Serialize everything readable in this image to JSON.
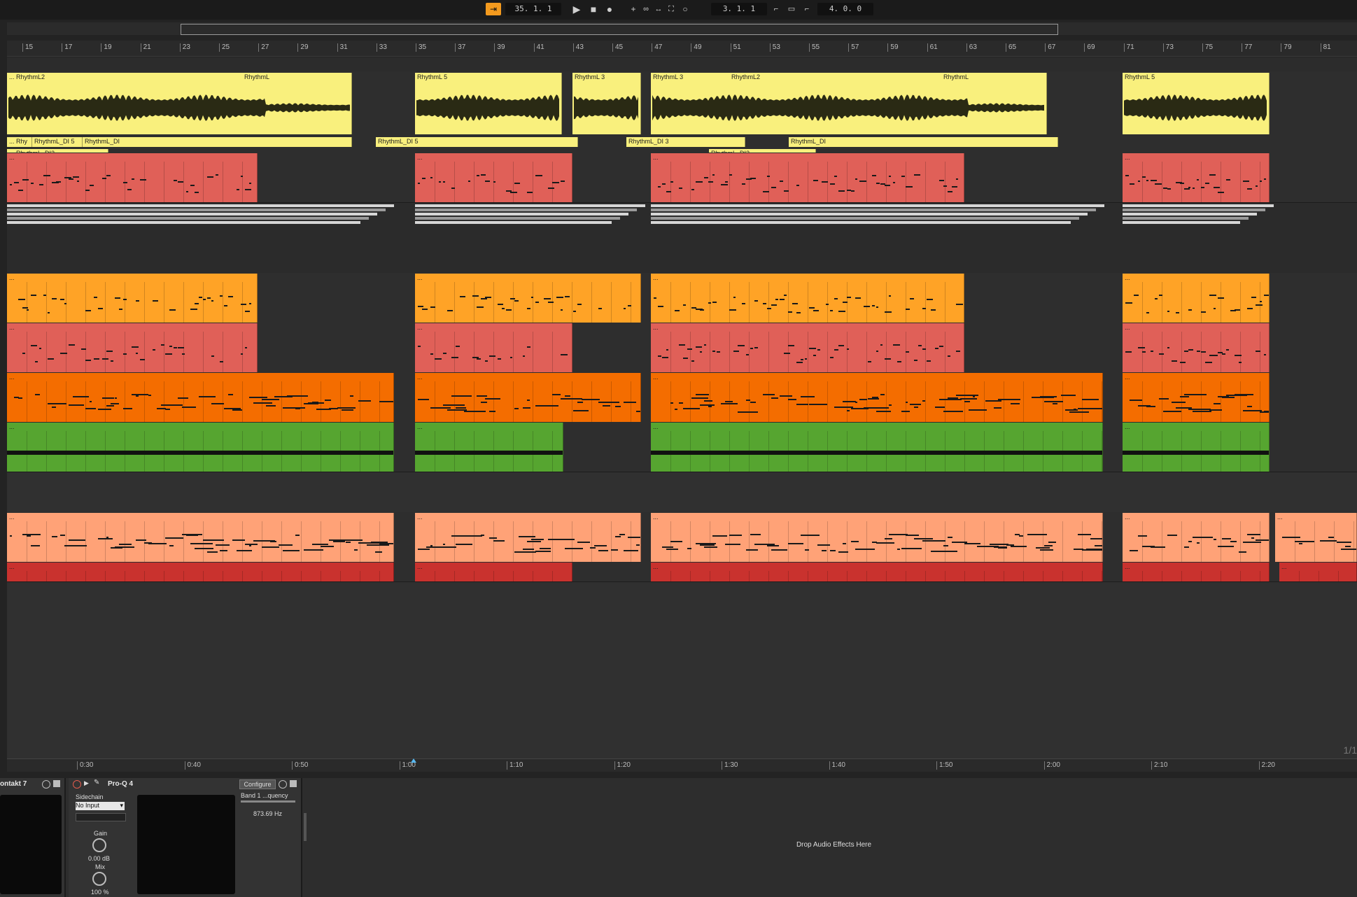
{
  "transport": {
    "position": "35.  1.  1",
    "loop_start": "3.  1.  1",
    "loop_length": "4.  0.  0"
  },
  "ruler": {
    "bars": [
      "15",
      "17",
      "19",
      "21",
      "23",
      "25",
      "27",
      "29",
      "31",
      "33",
      "35",
      "37",
      "39",
      "41",
      "43",
      "45",
      "47",
      "49",
      "51",
      "53",
      "55",
      "57",
      "59",
      "61",
      "63",
      "65",
      "67",
      "69",
      "71",
      "73",
      "75",
      "77",
      "79",
      "81"
    ]
  },
  "time_ruler": {
    "marks": [
      "0:30",
      "0:40",
      "0:50",
      "1:00",
      "1:10",
      "1:20",
      "1:30",
      "1:40",
      "1:50",
      "2:00",
      "2:10",
      "2:20"
    ]
  },
  "audio_clips": [
    {
      "name": "... RhythmL2"
    },
    {
      "name": "RhythmL"
    },
    {
      "name": "RhythmL 5"
    },
    {
      "name": "RhythmL 3"
    },
    {
      "name": "RhythmL 3"
    },
    {
      "name": "RhythmL2"
    },
    {
      "name": "RhythmL"
    },
    {
      "name": "RhythmL 5"
    }
  ],
  "di_clips": [
    {
      "name": "... Rhy"
    },
    {
      "name": "RhythmL_DI 5"
    },
    {
      "name": "RhythmL_DI"
    },
    {
      "name": "RhythmL_DI 5"
    },
    {
      "name": "RhythmL_DI 3"
    },
    {
      "name": "RhythmL_DI"
    },
    {
      "name": "... RhythmL_DI2"
    },
    {
      "name": "RhythmL_DI2"
    }
  ],
  "colors": {
    "yellow": "#f9f07d",
    "salmon_red": "#e06058",
    "amber": "#ffa326",
    "orange": "#f46d00",
    "green": "#56a530",
    "peach": "#ffa277",
    "dark_red": "#c9322e"
  },
  "page_indicator": "1/1",
  "devices": {
    "kontakt": {
      "title": "ontakt 7"
    },
    "proq": {
      "title": "Pro-Q 4",
      "sidechain_label": "Sidechain",
      "sidechain_value": "No Input",
      "gain_label": "Gain",
      "gain_value": "0.00 dB",
      "mix_label": "Mix",
      "mix_value": "100 %",
      "configure_label": "Configure",
      "band_label": "Band 1 ...quency",
      "band_value": "873.69 Hz"
    },
    "drop_label": "Drop Audio Effects Here"
  },
  "icons": [
    "play-icon",
    "stop-icon",
    "record-icon",
    "arrangement-record-icon",
    "draw-icon",
    "loop-icon"
  ]
}
